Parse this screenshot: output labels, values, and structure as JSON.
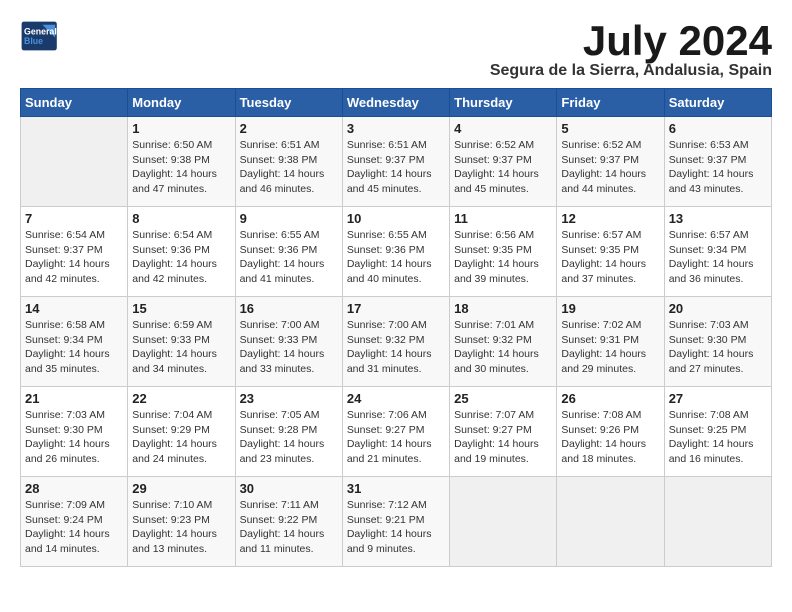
{
  "header": {
    "logo_line1": "General",
    "logo_line2": "Blue",
    "month_title": "July 2024",
    "location": "Segura de la Sierra, Andalusia, Spain"
  },
  "days_of_week": [
    "Sunday",
    "Monday",
    "Tuesday",
    "Wednesday",
    "Thursday",
    "Friday",
    "Saturday"
  ],
  "weeks": [
    [
      {
        "day": "",
        "content": ""
      },
      {
        "day": "1",
        "content": "Sunrise: 6:50 AM\nSunset: 9:38 PM\nDaylight: 14 hours\nand 47 minutes."
      },
      {
        "day": "2",
        "content": "Sunrise: 6:51 AM\nSunset: 9:38 PM\nDaylight: 14 hours\nand 46 minutes."
      },
      {
        "day": "3",
        "content": "Sunrise: 6:51 AM\nSunset: 9:37 PM\nDaylight: 14 hours\nand 45 minutes."
      },
      {
        "day": "4",
        "content": "Sunrise: 6:52 AM\nSunset: 9:37 PM\nDaylight: 14 hours\nand 45 minutes."
      },
      {
        "day": "5",
        "content": "Sunrise: 6:52 AM\nSunset: 9:37 PM\nDaylight: 14 hours\nand 44 minutes."
      },
      {
        "day": "6",
        "content": "Sunrise: 6:53 AM\nSunset: 9:37 PM\nDaylight: 14 hours\nand 43 minutes."
      }
    ],
    [
      {
        "day": "7",
        "content": "Sunrise: 6:54 AM\nSunset: 9:37 PM\nDaylight: 14 hours\nand 42 minutes."
      },
      {
        "day": "8",
        "content": "Sunrise: 6:54 AM\nSunset: 9:36 PM\nDaylight: 14 hours\nand 42 minutes."
      },
      {
        "day": "9",
        "content": "Sunrise: 6:55 AM\nSunset: 9:36 PM\nDaylight: 14 hours\nand 41 minutes."
      },
      {
        "day": "10",
        "content": "Sunrise: 6:55 AM\nSunset: 9:36 PM\nDaylight: 14 hours\nand 40 minutes."
      },
      {
        "day": "11",
        "content": "Sunrise: 6:56 AM\nSunset: 9:35 PM\nDaylight: 14 hours\nand 39 minutes."
      },
      {
        "day": "12",
        "content": "Sunrise: 6:57 AM\nSunset: 9:35 PM\nDaylight: 14 hours\nand 37 minutes."
      },
      {
        "day": "13",
        "content": "Sunrise: 6:57 AM\nSunset: 9:34 PM\nDaylight: 14 hours\nand 36 minutes."
      }
    ],
    [
      {
        "day": "14",
        "content": "Sunrise: 6:58 AM\nSunset: 9:34 PM\nDaylight: 14 hours\nand 35 minutes."
      },
      {
        "day": "15",
        "content": "Sunrise: 6:59 AM\nSunset: 9:33 PM\nDaylight: 14 hours\nand 34 minutes."
      },
      {
        "day": "16",
        "content": "Sunrise: 7:00 AM\nSunset: 9:33 PM\nDaylight: 14 hours\nand 33 minutes."
      },
      {
        "day": "17",
        "content": "Sunrise: 7:00 AM\nSunset: 9:32 PM\nDaylight: 14 hours\nand 31 minutes."
      },
      {
        "day": "18",
        "content": "Sunrise: 7:01 AM\nSunset: 9:32 PM\nDaylight: 14 hours\nand 30 minutes."
      },
      {
        "day": "19",
        "content": "Sunrise: 7:02 AM\nSunset: 9:31 PM\nDaylight: 14 hours\nand 29 minutes."
      },
      {
        "day": "20",
        "content": "Sunrise: 7:03 AM\nSunset: 9:30 PM\nDaylight: 14 hours\nand 27 minutes."
      }
    ],
    [
      {
        "day": "21",
        "content": "Sunrise: 7:03 AM\nSunset: 9:30 PM\nDaylight: 14 hours\nand 26 minutes."
      },
      {
        "day": "22",
        "content": "Sunrise: 7:04 AM\nSunset: 9:29 PM\nDaylight: 14 hours\nand 24 minutes."
      },
      {
        "day": "23",
        "content": "Sunrise: 7:05 AM\nSunset: 9:28 PM\nDaylight: 14 hours\nand 23 minutes."
      },
      {
        "day": "24",
        "content": "Sunrise: 7:06 AM\nSunset: 9:27 PM\nDaylight: 14 hours\nand 21 minutes."
      },
      {
        "day": "25",
        "content": "Sunrise: 7:07 AM\nSunset: 9:27 PM\nDaylight: 14 hours\nand 19 minutes."
      },
      {
        "day": "26",
        "content": "Sunrise: 7:08 AM\nSunset: 9:26 PM\nDaylight: 14 hours\nand 18 minutes."
      },
      {
        "day": "27",
        "content": "Sunrise: 7:08 AM\nSunset: 9:25 PM\nDaylight: 14 hours\nand 16 minutes."
      }
    ],
    [
      {
        "day": "28",
        "content": "Sunrise: 7:09 AM\nSunset: 9:24 PM\nDaylight: 14 hours\nand 14 minutes."
      },
      {
        "day": "29",
        "content": "Sunrise: 7:10 AM\nSunset: 9:23 PM\nDaylight: 14 hours\nand 13 minutes."
      },
      {
        "day": "30",
        "content": "Sunrise: 7:11 AM\nSunset: 9:22 PM\nDaylight: 14 hours\nand 11 minutes."
      },
      {
        "day": "31",
        "content": "Sunrise: 7:12 AM\nSunset: 9:21 PM\nDaylight: 14 hours\nand 9 minutes."
      },
      {
        "day": "",
        "content": ""
      },
      {
        "day": "",
        "content": ""
      },
      {
        "day": "",
        "content": ""
      }
    ]
  ]
}
